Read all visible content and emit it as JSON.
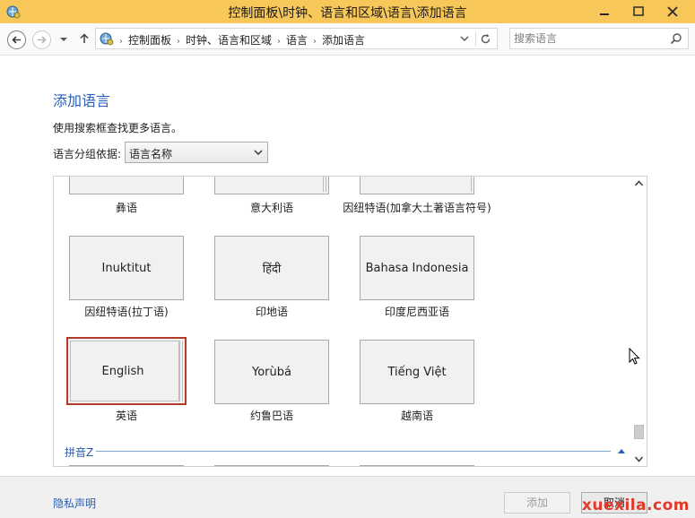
{
  "window": {
    "title": "控制面板\\时钟、语言和区域\\语言\\添加语言"
  },
  "address": {
    "crumbs": [
      "控制面板",
      "时钟、语言和区域",
      "语言",
      "添加语言"
    ]
  },
  "search": {
    "placeholder": "搜索语言"
  },
  "main": {
    "title": "添加语言",
    "hint": "使用搜索框查找更多语言。",
    "group_label": "语言分组依据:",
    "group_value": "语言名称"
  },
  "tiles": {
    "row0": [
      {
        "name": "",
        "label": "彝语"
      },
      {
        "name": "",
        "label": "意大利语"
      },
      {
        "name": "",
        "label": "因纽特语(加拿大土著语言符号)"
      }
    ],
    "row1": [
      {
        "name": "Inuktitut",
        "label": "因纽特语(拉丁语)"
      },
      {
        "name": "हिंदी",
        "label": "印地语"
      },
      {
        "name": "Bahasa Indonesia",
        "label": "印度尼西亚语"
      }
    ],
    "row2": [
      {
        "name": "English",
        "label": "英语"
      },
      {
        "name": "Yorùbá",
        "label": "约鲁巴语"
      },
      {
        "name": "Tiếng Việt",
        "label": "越南语"
      }
    ]
  },
  "section": {
    "label": "拼音Z"
  },
  "footer": {
    "privacy": "隐私声明",
    "add": "添加",
    "cancel": "取消"
  },
  "watermark": "xuexila.com",
  "colors": {
    "titlebar": "#f7c75a",
    "accent": "#2a5fb4",
    "selected_border": "#b43a2a",
    "watermark": "#e03a2a"
  }
}
